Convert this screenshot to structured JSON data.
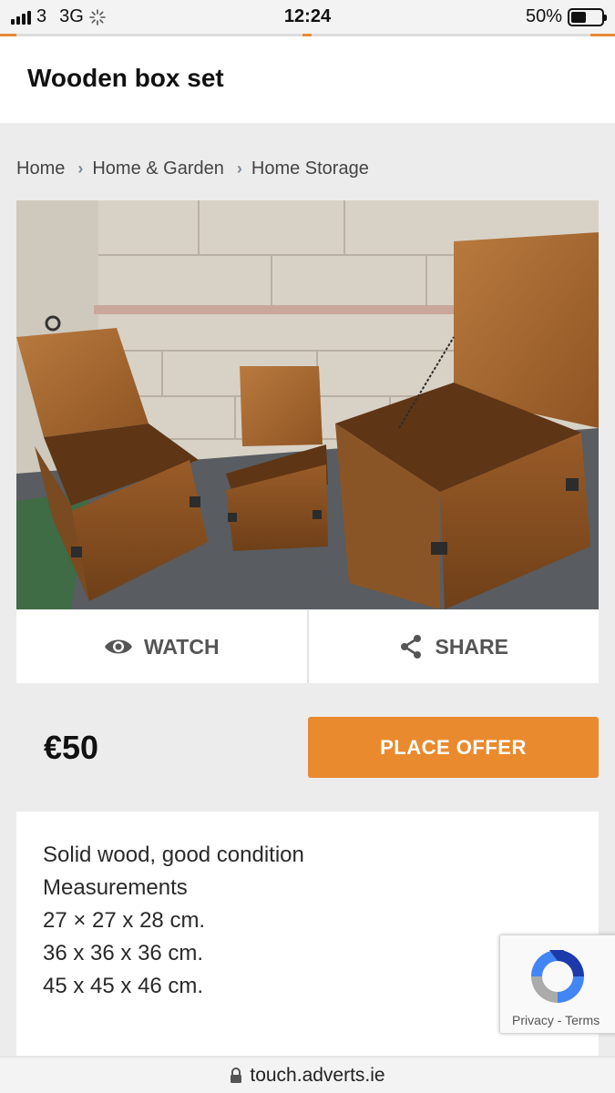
{
  "status_bar": {
    "carrier": "3",
    "network": "3G",
    "time": "12:24",
    "battery_percent": "50%",
    "battery_level": 0.5,
    "icons": [
      "signal-icon",
      "loading-icon",
      "battery-icon"
    ]
  },
  "page": {
    "title": "Wooden box set"
  },
  "breadcrumb": {
    "items": [
      "Home",
      "Home & Garden",
      "Home Storage"
    ]
  },
  "listing": {
    "watch_label": "WATCH",
    "share_label": "SHARE",
    "price": "€50",
    "offer_label": "PLACE OFFER",
    "description": [
      "Solid wood, good condition",
      "Measurements",
      "27 × 27 x 28 cm.",
      "36 x 36 x 36 cm.",
      "45 x 45 x 46 cm."
    ]
  },
  "recaptcha": {
    "privacy": "Privacy",
    "separator": "-",
    "terms": "Terms"
  },
  "url_bar": {
    "url": "touch.adverts.ie"
  },
  "colors": {
    "accent": "#ea8a2e",
    "background": "#ececec"
  }
}
